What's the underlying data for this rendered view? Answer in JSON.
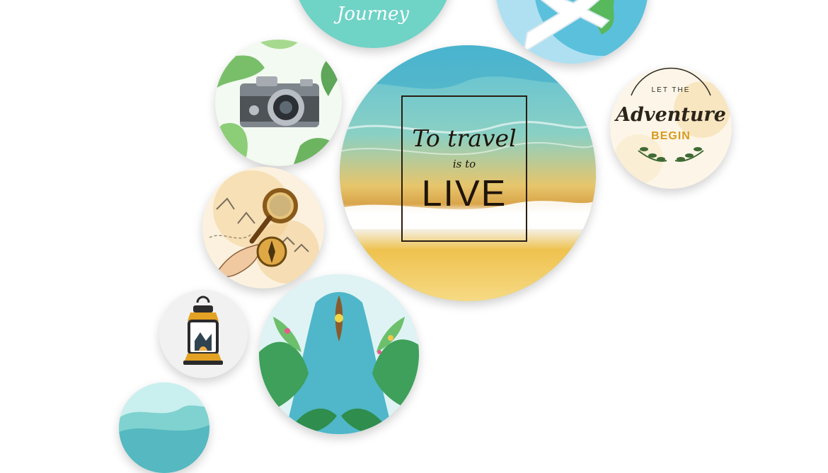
{
  "collage": {
    "title_circle": {
      "line1": "To travel",
      "line2": "is to",
      "line3": "LIVE"
    },
    "journey_circle": {
      "text": "Journey"
    },
    "adventure_circle": {
      "top": "LET THE",
      "middle": "Adventure",
      "bottom": "BEGIN"
    },
    "icons": [
      "airplane-icon",
      "globe-icon",
      "camera-icon",
      "magnifying-glass-icon",
      "compass-icon",
      "lantern-icon",
      "canoe-icon",
      "leaf-icon"
    ],
    "colors": {
      "teal": "#6fd3c6",
      "sky": "#aee0f2",
      "sand": "#f3c95a",
      "ink": "#1f140a"
    }
  }
}
